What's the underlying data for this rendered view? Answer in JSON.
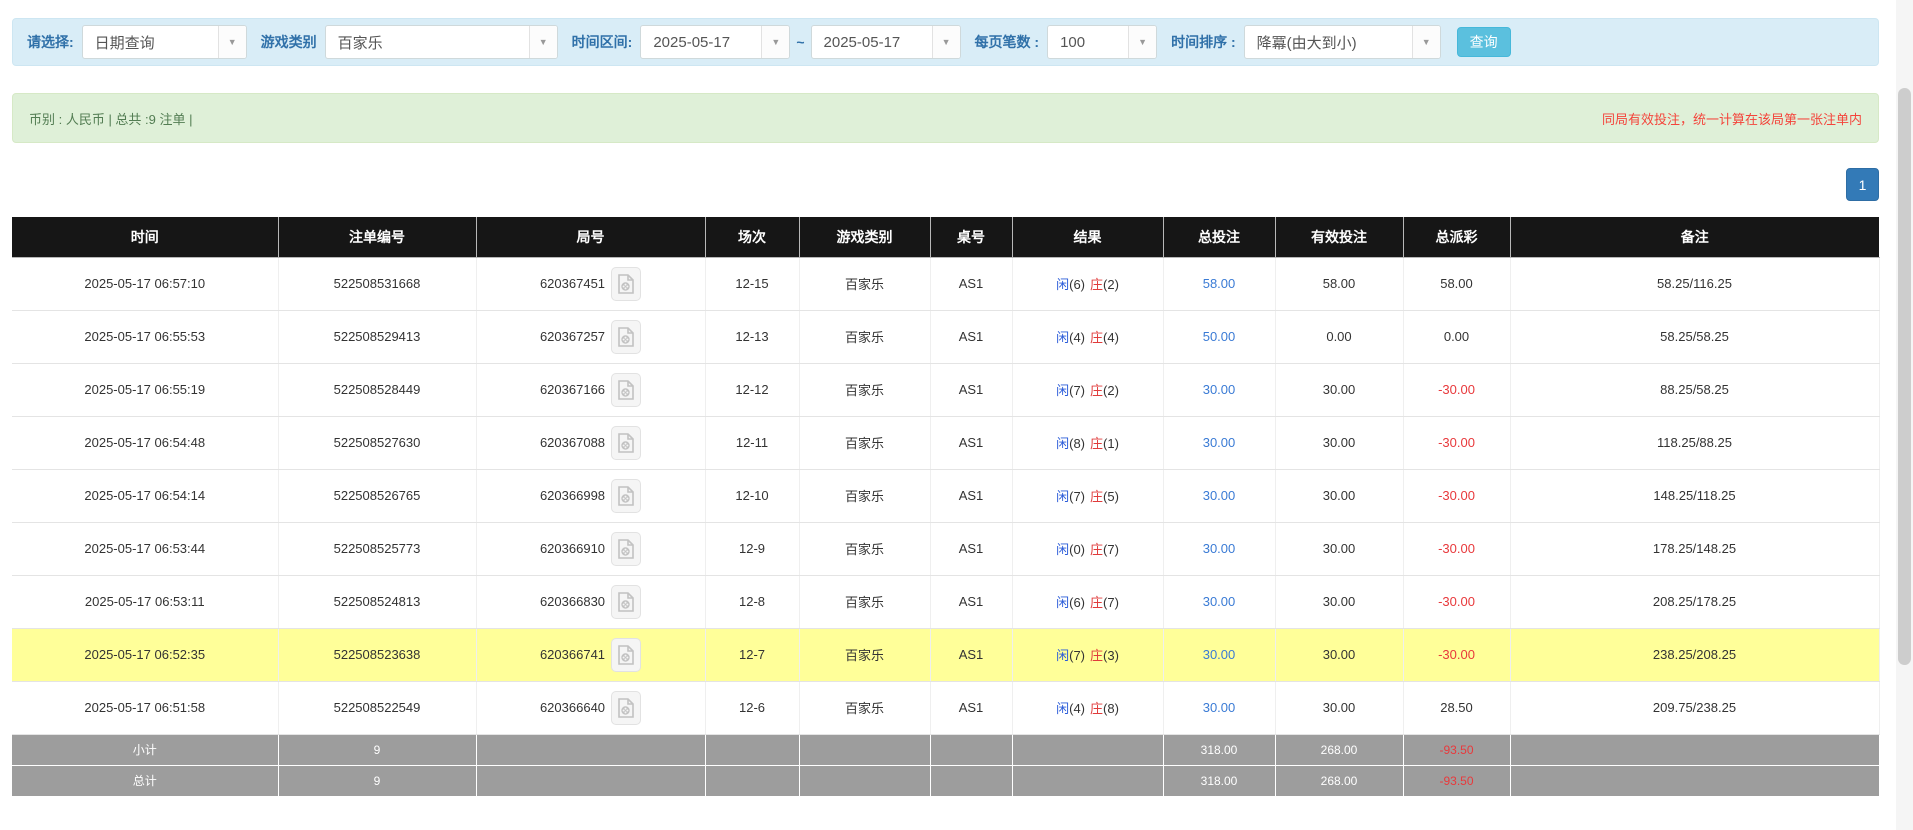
{
  "toolbar": {
    "select_label": "请选择:",
    "select_value": "日期查询",
    "game_label": "游戏类别",
    "game_value": "百家乐",
    "range_label": "时间区间:",
    "date_from": "2025-05-17",
    "range_tilde": "~",
    "date_to": "2025-05-17",
    "page_size_label": "每页笔数 :",
    "page_size_value": "100",
    "sort_label": "时间排序 :",
    "sort_value": "降冪(由大到小)",
    "search_button": "查询",
    "chevron": "▼"
  },
  "info_bar": {
    "left": "币别 : 人民币 | 总共 :9 注单 |",
    "right": "同局有效投注，统一计算在该局第一张注单内"
  },
  "pagination": {
    "page": "1"
  },
  "table": {
    "headers": [
      "时间",
      "注单编号",
      "局号",
      "场次",
      "游戏类别",
      "桌号",
      "结果",
      "总投注",
      "有效投注",
      "总派彩",
      "备注"
    ],
    "rows": [
      {
        "time": "2025-05-17 06:57:10",
        "bet_no": "522508531668",
        "round_no": "620367451",
        "session": "12-15",
        "game": "百家乐",
        "table_no": "AS1",
        "result_p": "闲",
        "result_p_n": "(6)",
        "result_b": "庄",
        "result_b_n": "(2)",
        "total_bet": "58.00",
        "valid_bet": "58.00",
        "payout": "58.00",
        "note": "58.25/116.25",
        "highlight": false
      },
      {
        "time": "2025-05-17 06:55:53",
        "bet_no": "522508529413",
        "round_no": "620367257",
        "session": "12-13",
        "game": "百家乐",
        "table_no": "AS1",
        "result_p": "闲",
        "result_p_n": "(4)",
        "result_b": "庄",
        "result_b_n": "(4)",
        "total_bet": "50.00",
        "valid_bet": "0.00",
        "payout": "0.00",
        "note": "58.25/58.25",
        "highlight": false
      },
      {
        "time": "2025-05-17 06:55:19",
        "bet_no": "522508528449",
        "round_no": "620367166",
        "session": "12-12",
        "game": "百家乐",
        "table_no": "AS1",
        "result_p": "闲",
        "result_p_n": "(7)",
        "result_b": "庄",
        "result_b_n": "(2)",
        "total_bet": "30.00",
        "valid_bet": "30.00",
        "payout": "-30.00",
        "note": "88.25/58.25",
        "highlight": false
      },
      {
        "time": "2025-05-17 06:54:48",
        "bet_no": "522508527630",
        "round_no": "620367088",
        "session": "12-11",
        "game": "百家乐",
        "table_no": "AS1",
        "result_p": "闲",
        "result_p_n": "(8)",
        "result_b": "庄",
        "result_b_n": "(1)",
        "total_bet": "30.00",
        "valid_bet": "30.00",
        "payout": "-30.00",
        "note": "118.25/88.25",
        "highlight": false
      },
      {
        "time": "2025-05-17 06:54:14",
        "bet_no": "522508526765",
        "round_no": "620366998",
        "session": "12-10",
        "game": "百家乐",
        "table_no": "AS1",
        "result_p": "闲",
        "result_p_n": "(7)",
        "result_b": "庄",
        "result_b_n": "(5)",
        "total_bet": "30.00",
        "valid_bet": "30.00",
        "payout": "-30.00",
        "note": "148.25/118.25",
        "highlight": false
      },
      {
        "time": "2025-05-17 06:53:44",
        "bet_no": "522508525773",
        "round_no": "620366910",
        "session": "12-9",
        "game": "百家乐",
        "table_no": "AS1",
        "result_p": "闲",
        "result_p_n": "(0)",
        "result_b": "庄",
        "result_b_n": "(7)",
        "total_bet": "30.00",
        "valid_bet": "30.00",
        "payout": "-30.00",
        "note": "178.25/148.25",
        "highlight": false
      },
      {
        "time": "2025-05-17 06:53:11",
        "bet_no": "522508524813",
        "round_no": "620366830",
        "session": "12-8",
        "game": "百家乐",
        "table_no": "AS1",
        "result_p": "闲",
        "result_p_n": "(6)",
        "result_b": "庄",
        "result_b_n": "(7)",
        "total_bet": "30.00",
        "valid_bet": "30.00",
        "payout": "-30.00",
        "note": "208.25/178.25",
        "highlight": false
      },
      {
        "time": "2025-05-17 06:52:35",
        "bet_no": "522508523638",
        "round_no": "620366741",
        "session": "12-7",
        "game": "百家乐",
        "table_no": "AS1",
        "result_p": "闲",
        "result_p_n": "(7)",
        "result_b": "庄",
        "result_b_n": "(3)",
        "total_bet": "30.00",
        "valid_bet": "30.00",
        "payout": "-30.00",
        "note": "238.25/208.25",
        "highlight": true
      },
      {
        "time": "2025-05-17 06:51:58",
        "bet_no": "522508522549",
        "round_no": "620366640",
        "session": "12-6",
        "game": "百家乐",
        "table_no": "AS1",
        "result_p": "闲",
        "result_p_n": "(4)",
        "result_b": "庄",
        "result_b_n": "(8)",
        "total_bet": "30.00",
        "valid_bet": "30.00",
        "payout": "28.50",
        "note": "209.75/238.25",
        "highlight": false
      }
    ],
    "subtotal": {
      "label": "小计",
      "count": "9",
      "total_bet": "318.00",
      "valid_bet": "268.00",
      "payout": "-93.50",
      "note": ""
    },
    "total": {
      "label": "总计",
      "count": "9",
      "total_bet": "318.00",
      "valid_bet": "268.00",
      "payout": "-93.50",
      "note": ""
    }
  },
  "colors": {
    "toolbar_bg": "#d9edf7",
    "info_bg": "#dff0d8",
    "accent_blue": "#337ab7",
    "search_btn": "#5bc0de",
    "header_bg": "#161616",
    "highlight_row": "#ffff99",
    "link_blue": "#3a7bd5",
    "player_blue": "#2b5cd9",
    "banker_red": "#e03b3b",
    "negative_red": "#e8393c",
    "footer_bg": "#9d9d9d"
  }
}
